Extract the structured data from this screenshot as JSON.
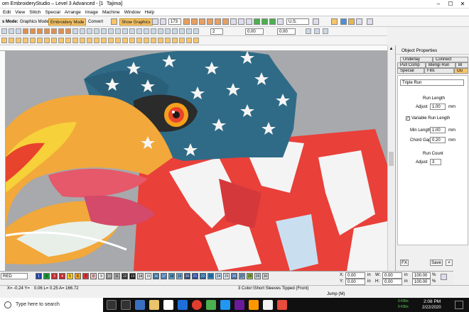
{
  "app": {
    "title": "om EmbroideryStudio – Level 3 Advanced - [1",
    "title_right": "Tajima]"
  },
  "menu": [
    "Edit",
    "View",
    "Stitch",
    "Special",
    "Arrange",
    "Image",
    "Machine",
    "Window",
    "Help"
  ],
  "toolbar1": {
    "mode_label": "s Mode:",
    "graphics_mode": "Graphics Mode",
    "embroidery_mode": "Embroidery Mode",
    "convert": "Convert",
    "show_graphics": "Show Graphics",
    "zoom_value": "173",
    "lang_value": "U.S."
  },
  "toolbar2": {
    "value1": "2",
    "value2": "0.00",
    "value3": "0.00"
  },
  "panel": {
    "title": "Object Properties",
    "tabs_row1": [
      "Underlay",
      "Connect"
    ],
    "tabs_row2": [
      "Pull Comp",
      "Blengi Run",
      "Bl"
    ],
    "tabs_row3": [
      "Special",
      "Fills",
      "Ou"
    ],
    "stitch_type": "Triple Run",
    "run_length_title": "Run Length",
    "adjust_label": "Adjust",
    "adjust_value": "1.00",
    "unit": "mm",
    "variable_label": "Variable Run Length",
    "min_length_label": "Min Length",
    "min_length_value": "1.00",
    "chord_gap_label": "Chord Gap",
    "chord_gap_value": "0.20",
    "run_count_title": "Run Count",
    "count_adjust_label": "Adjust",
    "count_value": "3",
    "fx": "FX",
    "save": "Save",
    "close": "×"
  },
  "colorbar": {
    "first": "RED",
    "swatches": [
      "1",
      "2",
      "3",
      "4",
      "5",
      "6",
      "7",
      "8",
      "9",
      "10",
      "11",
      "12",
      "13",
      "14",
      "15",
      "16",
      "17",
      "18",
      "19",
      "20",
      "21",
      "22",
      "23",
      "24",
      "25",
      "26",
      "27",
      "28",
      "29",
      "30"
    ],
    "colors": [
      "#1f3fa6",
      "#1a9a3a",
      "#c0272d",
      "#c0272d",
      "#f7d31a",
      "#f0a020",
      "#e03030",
      "#f0c0c0",
      "#f5f5f5",
      "#808080",
      "#b0b0b0",
      "#2a2a2a",
      "#101010",
      "#d9d9d9",
      "#ffffff",
      "#2c6a9a",
      "#3f7bc1",
      "#4aa0d8",
      "#6ab0e0",
      "#22407a",
      "#2040a0",
      "#1a5a9a",
      "#2f86c6",
      "#c9e1f3",
      "#e8f2fb",
      "#3a6aa0",
      "#7aa0c8",
      "#90c040",
      "#c8d8e8",
      "#e0e0e0"
    ]
  },
  "coords": {
    "x_label": "X:",
    "x_value": "0.00",
    "y_label": "Y:",
    "y_value": "0.00",
    "w_label": "W:",
    "w_value": "0.00",
    "h_label": "H:",
    "h_value": "0.00",
    "unit": "in",
    "pct1": "100.00",
    "pct2": "100.00",
    "pct_unit": "%"
  },
  "status": {
    "x": "X= -0.24 Y=",
    "y": "0.06 L=",
    "l": "0.25 A= 166.72",
    "object": "3 Color:\\Short Sleeves Tipped (Front)",
    "jump": "Jump (M)"
  },
  "taskbar": {
    "search": "Type here to search",
    "time": "2:08 PM",
    "date": "2/22/2020",
    "net1": "0 KB/s",
    "net2": "0 KB/s"
  }
}
